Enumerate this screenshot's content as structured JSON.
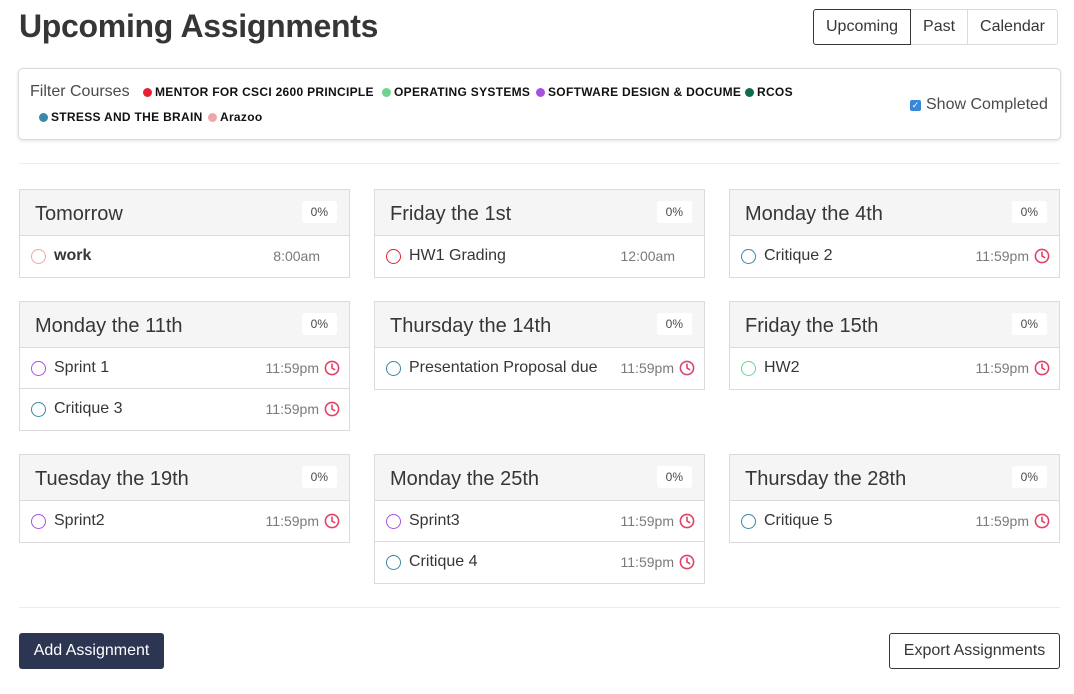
{
  "page": {
    "title": "Upcoming Assignments"
  },
  "tabs": [
    {
      "label": "Upcoming",
      "active": true
    },
    {
      "label": "Past",
      "active": false
    },
    {
      "label": "Calendar",
      "active": false
    }
  ],
  "filter": {
    "label": "Filter Courses",
    "courses": [
      {
        "name": "MENTOR FOR CSCI 2600 PRINCIPLE",
        "color": "#e8202f"
      },
      {
        "name": "OPERATING SYSTEMS",
        "color": "#6bd48f"
      },
      {
        "name": "SOFTWARE DESIGN & DOCUME",
        "color": "#a652e0"
      },
      {
        "name": "RCOS",
        "color": "#0f6b4d"
      },
      {
        "name": "STRESS AND THE BRAIN",
        "color": "#3a87a6"
      },
      {
        "name": "Arazoo",
        "color": "#eea6a8"
      }
    ],
    "show_completed_label": "Show Completed",
    "show_completed_checked": true
  },
  "days": [
    {
      "title": "Tomorrow",
      "progress": "0%",
      "assignments": [
        {
          "name": "work",
          "time": "8:00am",
          "color": "#eea6a8",
          "bold": true,
          "overdue": false
        }
      ]
    },
    {
      "title": "Friday the 1st",
      "progress": "0%",
      "assignments": [
        {
          "name": "HW1 Grading",
          "time": "12:00am",
          "color": "#e8202f",
          "bold": false,
          "overdue": false
        }
      ]
    },
    {
      "title": "Monday the 4th",
      "progress": "0%",
      "assignments": [
        {
          "name": "Critique 2",
          "time": "11:59pm",
          "color": "#3a87a6",
          "bold": false,
          "overdue": true
        }
      ]
    },
    {
      "title": "Monday the 11th",
      "progress": "0%",
      "assignments": [
        {
          "name": "Sprint 1",
          "time": "11:59pm",
          "color": "#a652e0",
          "bold": false,
          "overdue": true
        },
        {
          "name": "Critique 3",
          "time": "11:59pm",
          "color": "#3a87a6",
          "bold": false,
          "overdue": true
        }
      ]
    },
    {
      "title": "Thursday the 14th",
      "progress": "0%",
      "assignments": [
        {
          "name": "Presentation Proposal due",
          "time": "11:59pm",
          "color": "#3a87a6",
          "bold": false,
          "overdue": true
        }
      ]
    },
    {
      "title": "Friday the 15th",
      "progress": "0%",
      "assignments": [
        {
          "name": "HW2",
          "time": "11:59pm",
          "color": "#6bd48f",
          "bold": false,
          "overdue": true
        }
      ]
    },
    {
      "title": "Tuesday the 19th",
      "progress": "0%",
      "assignments": [
        {
          "name": "Sprint2",
          "time": "11:59pm",
          "color": "#a652e0",
          "bold": false,
          "overdue": true
        }
      ]
    },
    {
      "title": "Monday the 25th",
      "progress": "0%",
      "assignments": [
        {
          "name": "Sprint3",
          "time": "11:59pm",
          "color": "#a652e0",
          "bold": false,
          "overdue": true
        },
        {
          "name": "Critique 4",
          "time": "11:59pm",
          "color": "#3a87a6",
          "bold": false,
          "overdue": true
        }
      ]
    },
    {
      "title": "Thursday the 28th",
      "progress": "0%",
      "assignments": [
        {
          "name": "Critique 5",
          "time": "11:59pm",
          "color": "#3a87a6",
          "bold": false,
          "overdue": true
        }
      ]
    }
  ],
  "overdue_color": "#e0436a",
  "actions": {
    "add_label": "Add Assignment",
    "export_label": "Export Assignments"
  }
}
